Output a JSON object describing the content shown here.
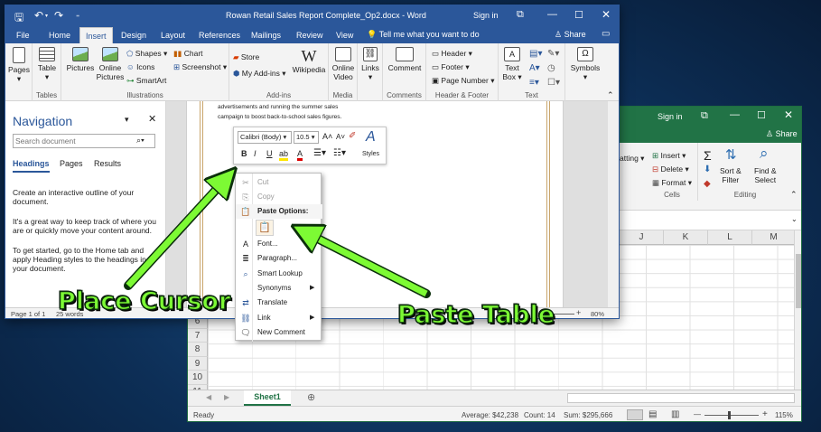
{
  "excel": {
    "signin": "Sign in",
    "share": "Share",
    "ribbon": {
      "insert": "Insert",
      "delete": "Delete",
      "format": "Format",
      "cells_label": "Cells",
      "sort_filter": "Sort &\nFilter",
      "find_select": "Find &\nSelect",
      "editing_label": "Editing",
      "partial": "atting"
    },
    "columns": [
      "J",
      "K",
      "L",
      "M"
    ],
    "rows": [
      "6",
      "7",
      "8",
      "9",
      "10",
      "11"
    ],
    "sheet_tab": "Sheet1",
    "status": {
      "ready": "Ready",
      "average": "Average: $42,238",
      "count": "Count: 14",
      "sum": "Sum: $295,666",
      "zoom": "115%"
    }
  },
  "word": {
    "title": "Rowan Retail Sales Report Complete_Op2.docx - Word",
    "signin": "Sign in",
    "tabs": [
      "File",
      "Home",
      "Insert",
      "Design",
      "Layout",
      "References",
      "Mailings",
      "Review",
      "View"
    ],
    "tell_me": "Tell me what you want to do",
    "share": "Share",
    "ribbon": {
      "pages": "Pages",
      "table": "Table",
      "tables_label": "Tables",
      "pictures": "Pictures",
      "online_pictures": "Online\nPictures",
      "shapes": "Shapes",
      "icons": "Icons",
      "smartart": "SmartArt",
      "chart": "Chart",
      "screenshot": "Screenshot",
      "illustrations_label": "Illustrations",
      "store": "Store",
      "my_addins": "My Add-ins",
      "wikipedia": "Wikipedia",
      "addins_label": "Add-ins",
      "online_video": "Online\nVideo",
      "media_label": "Media",
      "links": "Links",
      "comment": "Comment",
      "comments_label": "Comments",
      "header": "Header",
      "footer": "Footer",
      "page_number": "Page Number",
      "header_footer_label": "Header & Footer",
      "text_box": "Text\nBox",
      "text_label": "Text",
      "symbols": "Symbols"
    },
    "nav": {
      "title": "Navigation",
      "search_placeholder": "Search document",
      "tabs": [
        "Headings",
        "Pages",
        "Results"
      ],
      "p1": "Create an interactive outline of your document.",
      "p2": "It's a great way to keep track of where you are or quickly move your content around.",
      "p3": "To get started, go to the Home tab and apply Heading styles to the headings in your document."
    },
    "doc_text": [
      "advertisements and running the summer sales",
      "campaign to boost back-to-school sales figures."
    ],
    "status": {
      "page": "Page 1 of 1",
      "words": "25 words",
      "zoom": "80%"
    }
  },
  "minitoolbar": {
    "font": "Calibri (Body)",
    "size": "10.5",
    "styles": "Styles"
  },
  "context_menu": {
    "items": [
      "Cut",
      "Copy",
      "Paste Options:",
      "Font...",
      "Paragraph...",
      "Smart Lookup",
      "Synonyms",
      "Translate",
      "Link",
      "New Comment"
    ]
  },
  "annotations": {
    "left": "Place Cursor",
    "right": "Paste Table",
    "color": "#7dfa34"
  }
}
